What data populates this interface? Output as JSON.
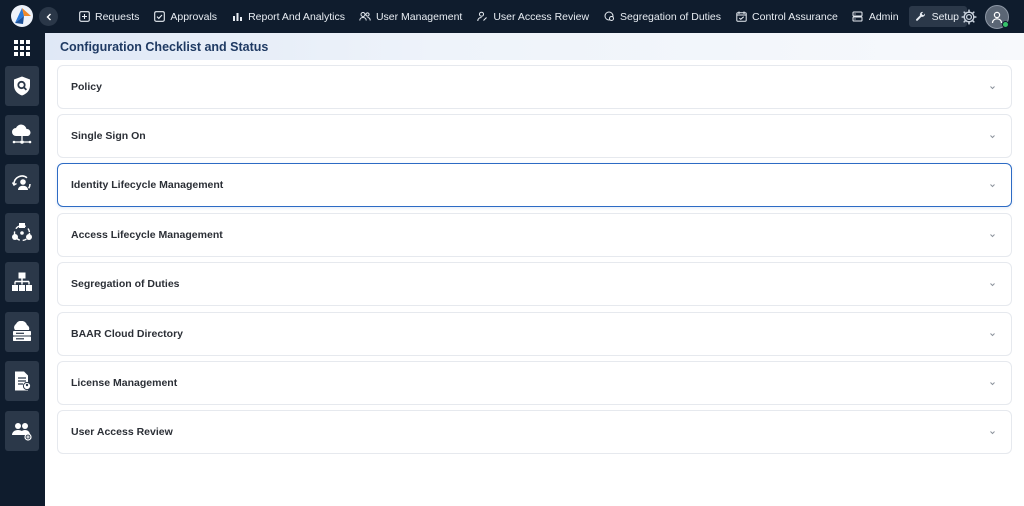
{
  "topnav": {
    "items": [
      {
        "label": "Requests",
        "icon": "plus-box-icon"
      },
      {
        "label": "Approvals",
        "icon": "check-box-icon"
      },
      {
        "label": "Report And Analytics",
        "icon": "bar-chart-icon"
      },
      {
        "label": "User Management",
        "icon": "users-icon"
      },
      {
        "label": "User Access Review",
        "icon": "user-review-icon"
      },
      {
        "label": "Segregation of Duties",
        "icon": "sod-icon"
      },
      {
        "label": "Control Assurance",
        "icon": "calendar-check-icon"
      },
      {
        "label": "Admin",
        "icon": "server-icon"
      },
      {
        "label": "Setup",
        "icon": "wrench-icon",
        "active": true
      }
    ]
  },
  "sidebar": {
    "items": [
      "search-shield-icon",
      "cloud-network-icon",
      "user-sync-icon",
      "workflow-icon",
      "hierarchy-icon",
      "cloud-server-icon",
      "document-user-icon",
      "users-settings-icon"
    ]
  },
  "page": {
    "title": "Configuration Checklist and Status"
  },
  "panels": [
    {
      "label": "Policy"
    },
    {
      "label": "Single Sign On"
    },
    {
      "label": "Identity Lifecycle Management",
      "active": true
    },
    {
      "label": "Access Lifecycle Management"
    },
    {
      "label": "Segregation of Duties"
    },
    {
      "label": "BAAR Cloud Directory"
    },
    {
      "label": "License Management"
    },
    {
      "label": "User Access Review"
    }
  ],
  "colors": {
    "nav_bg": "#0f1c2d",
    "accent": "#2d6bc4",
    "title": "#1f3a63"
  }
}
